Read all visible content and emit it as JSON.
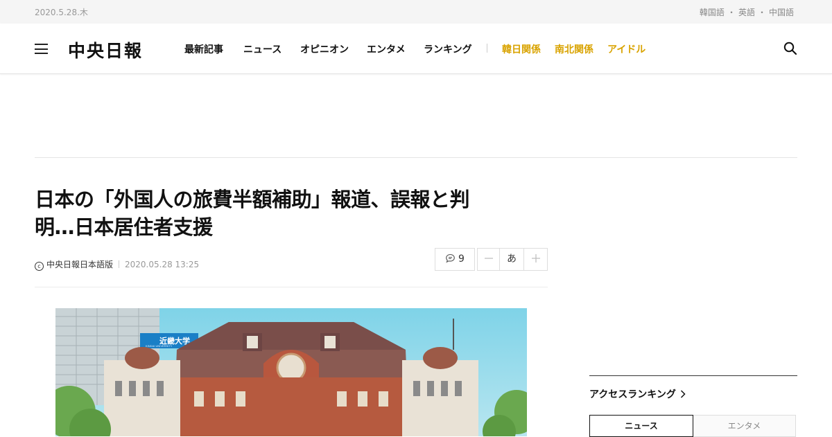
{
  "topbar": {
    "date": "2020.5.28.木",
    "languages": [
      "韓国語",
      "英語",
      "中国語"
    ],
    "separator": "・"
  },
  "header": {
    "logo": "中央日報",
    "nav": [
      {
        "label": "最新記事",
        "highlight": false
      },
      {
        "label": "ニュース",
        "highlight": false
      },
      {
        "label": "オピニオン",
        "highlight": false
      },
      {
        "label": "エンタメ",
        "highlight": false
      },
      {
        "label": "ランキング",
        "highlight": false
      },
      {
        "label": "韓日関係",
        "highlight": true
      },
      {
        "label": "南北関係",
        "highlight": true
      },
      {
        "label": "アイドル",
        "highlight": true
      }
    ],
    "menu_icon": "hamburger-icon",
    "search_icon": "search-icon"
  },
  "article": {
    "title_line1": "日本の「外国人の旅費半額補助」報道、誤報と判",
    "title_line2": "明…日本居住者支援",
    "copyright_symbol": "ⓒ",
    "source": "中央日報日本語版",
    "timestamp": "2020.05.28 13:25",
    "comment_count": "9",
    "font_label": "あ",
    "photo_sign": "近畿大学",
    "photo_sign_sub": "KINDAI UNIVERSITY"
  },
  "sidebar": {
    "ranking_title": "アクセスランキング",
    "tabs": [
      {
        "label": "ニュース",
        "active": true
      },
      {
        "label": "エンタメ",
        "active": false
      }
    ]
  },
  "colors": {
    "accent_gold": "#d9a300",
    "text": "#111111",
    "muted": "#999999"
  }
}
